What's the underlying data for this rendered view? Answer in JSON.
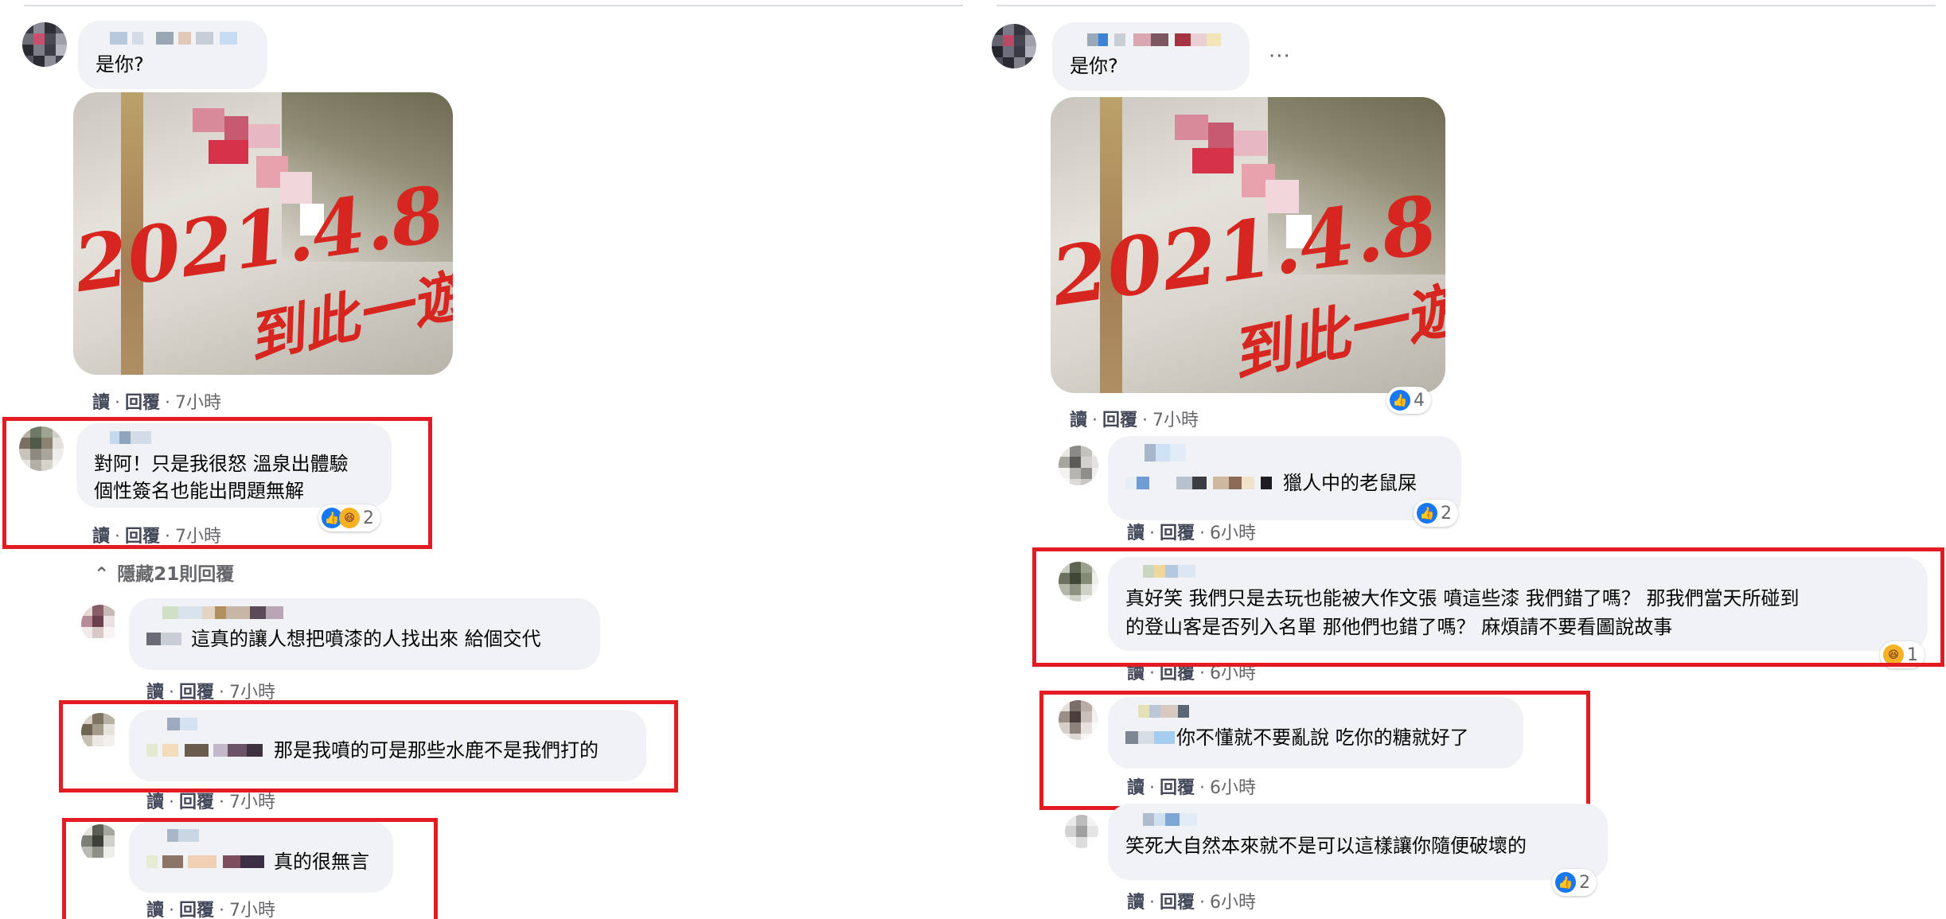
{
  "left": {
    "top_comment": {
      "text": "是你?",
      "actions": [
        "讀",
        "回覆"
      ],
      "time": "7小時"
    },
    "photo": {
      "date_text": "2021.4.8",
      "signature": "到此一遊"
    },
    "comments": [
      {
        "id": "c1",
        "text_line1": "對阿！只是我很怒 溫泉出體驗",
        "text_line2": "個性簽名也能出問題無解",
        "actions": [
          "讀",
          "回覆"
        ],
        "time": "7小時",
        "reaction_count": "2"
      },
      {
        "id": "c2",
        "text": "這真的讓人想把噴漆的人找出來 給個交代",
        "actions": [
          "讀",
          "回覆"
        ],
        "time": "7小時"
      },
      {
        "id": "c3",
        "text": "那是我噴的可是那些水鹿不是我們打的",
        "actions": [
          "讀",
          "回覆"
        ],
        "time": "7小時"
      },
      {
        "id": "c4",
        "text": "真的很無言",
        "actions": [
          "讀",
          "回覆"
        ],
        "time": "7小時"
      }
    ],
    "hide_replies": "隱藏21則回覆"
  },
  "right": {
    "top_comment": {
      "text": "是你?",
      "more": "···",
      "actions": [
        "讀",
        "回覆"
      ],
      "time": "7小時",
      "reaction_count": "4"
    },
    "photo": {
      "date_text": "2021.4.8",
      "signature": "到此一遊"
    },
    "comments": [
      {
        "id": "r1",
        "text": "獵人中的老鼠屎",
        "actions": [
          "讀",
          "回覆"
        ],
        "time": "6小時",
        "reaction_count": "2"
      },
      {
        "id": "r2",
        "text_line1": "真好笑 我們只是去玩也能被大作文張 噴這些漆 我們錯了嗎？ 那我們當天所碰到",
        "text_line2": "的登山客是否列入名單 那他們也錯了嗎？ 麻煩請不要看圖說故事",
        "actions": [
          "讀",
          "回覆"
        ],
        "time": "6小時",
        "reaction_count": "1"
      },
      {
        "id": "r3",
        "text": "你不懂就不要亂說 吃你的糖就好了",
        "actions": [
          "讀",
          "回覆"
        ],
        "time": "6小時"
      },
      {
        "id": "r4",
        "text": "笑死大自然本來就不是可以這樣讓你隨便破壞的",
        "actions": [
          "讀",
          "回覆"
        ],
        "time": "6小時",
        "reaction_count": "2"
      }
    ]
  },
  "colors": {
    "highlight_box": "#e31b23",
    "bubble_bg": "#f0f2f5",
    "like_blue": "#1877f2",
    "haha_yellow": "#f7b125",
    "meta_gray": "#65676b"
  },
  "icons": {
    "like": "thumbs-up-icon",
    "haha": "laughing-face-icon",
    "collapse": "chevron-up-icon"
  }
}
